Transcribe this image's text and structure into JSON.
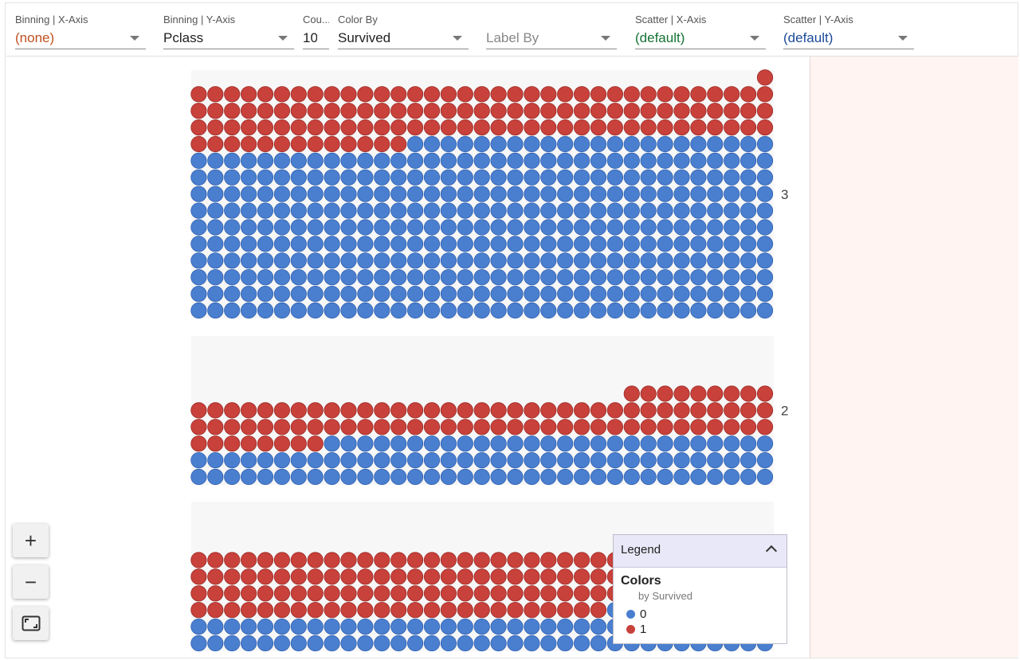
{
  "toolbar": {
    "binning_x": {
      "label": "Binning | X-Axis",
      "value": "(none)",
      "color": "#c0501f"
    },
    "binning_y": {
      "label": "Binning | Y-Axis",
      "value": "Pclass",
      "color": "#222222"
    },
    "count": {
      "label": "Cou...",
      "value": "10",
      "color": "#222222"
    },
    "color_by": {
      "label": "Color By",
      "value": "Survived",
      "color": "#222222"
    },
    "label_by": {
      "label": "",
      "placeholder": "Label By",
      "color": "#888888"
    },
    "scatter_x": {
      "label": "Scatter | X-Axis",
      "value": "(default)",
      "color": "#137333"
    },
    "scatter_y": {
      "label": "Scatter | Y-Axis",
      "value": "(default)",
      "color": "#1a4a9a"
    }
  },
  "colors": {
    "survived_0": "#4a7fd0",
    "survived_1": "#c8413b",
    "bin_bg": "#f7f7f7",
    "panel_bg": "#fff4f2"
  },
  "chart_data": {
    "type": "facets-dive-grid",
    "row_labels": [
      "3",
      "2"
    ],
    "rows": [
      {
        "label": "3",
        "count_0": 372,
        "count_1": 119
      },
      {
        "label": "2",
        "count_0": 97,
        "count_1": 87
      },
      {
        "label": "",
        "count_0": 80,
        "count_1": 136
      }
    ]
  },
  "zoom": {
    "in_label": "+",
    "out_label": "−",
    "fit_icon": "fit-to-screen-icon"
  },
  "legend": {
    "title": "Legend",
    "section": "Colors",
    "subtitle": "by Survived",
    "items": [
      {
        "label": "0",
        "color": "#4a7fd0"
      },
      {
        "label": "1",
        "color": "#c8413b"
      }
    ]
  }
}
